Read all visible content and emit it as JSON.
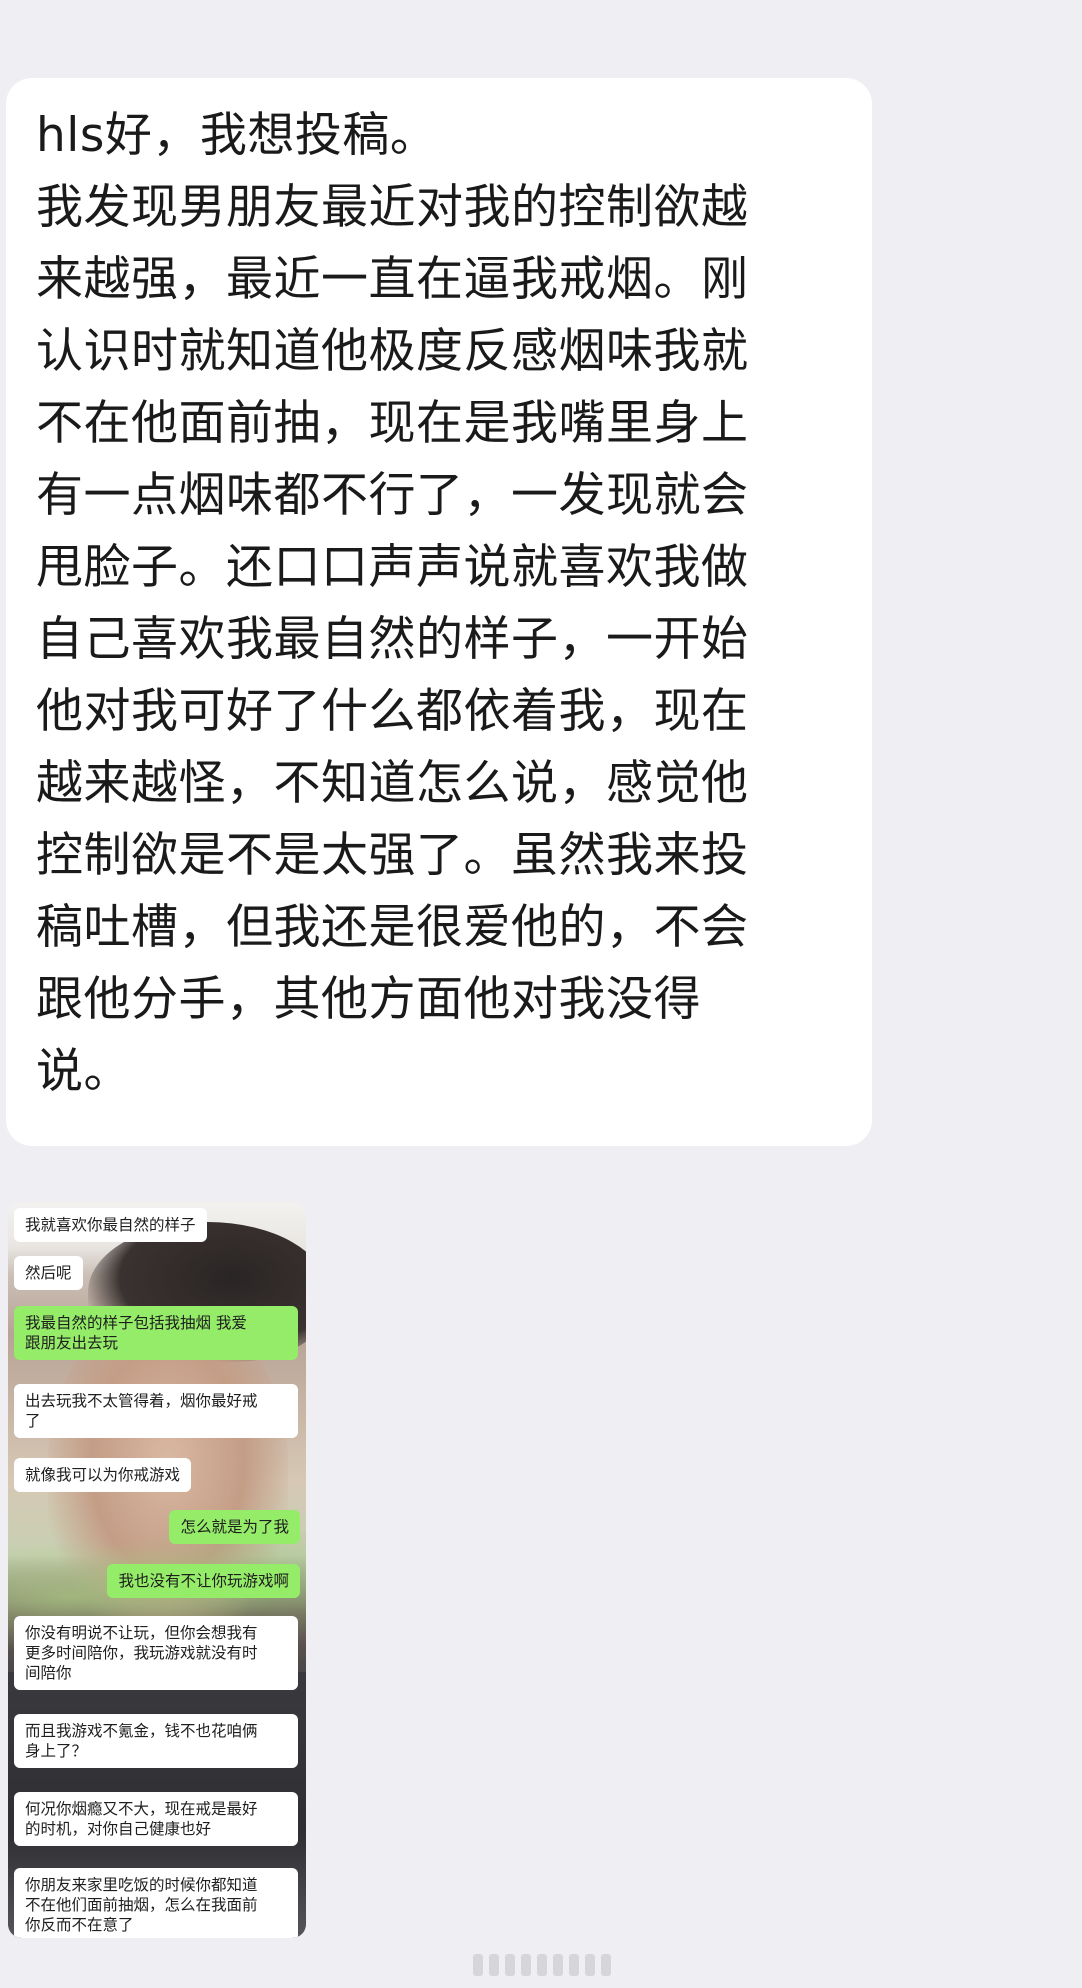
{
  "main_message": {
    "lines": [
      "hls好，我想投稿。",
      "我发现男朋友最近对我的控制欲越",
      "来越强，最近一直在逼我戒烟。刚",
      "认识时就知道他极度反感烟味我就",
      "不在他面前抽，现在是我嘴里身上",
      "有一点烟味都不行了，一发现就会",
      "甩脸子。还口口声声说就喜欢我做",
      "自己喜欢我最自然的样子，一开始",
      "他对我可好了什么都依着我，现在",
      "越来越怪，不知道怎么说，感觉他",
      "控制欲是不是太强了。虽然我来投",
      "稿吐槽，但我还是很爱他的，不会",
      "跟他分手，其他方面他对我没得",
      "说。"
    ]
  },
  "chat_screenshot": {
    "messages": [
      {
        "side": "left",
        "text": "我就喜欢你最自然的样子"
      },
      {
        "side": "left",
        "text": "然后呢"
      },
      {
        "side": "right",
        "text": "我最自然的样子包括我抽烟 我爱\n跟朋友出去玩"
      },
      {
        "side": "left",
        "text": "出去玩我不太管得着，烟你最好戒\n了"
      },
      {
        "side": "left",
        "text": "就像我可以为你戒游戏"
      },
      {
        "side": "right",
        "text": "怎么就是为了我"
      },
      {
        "side": "right",
        "text": "我也没有不让你玩游戏啊"
      },
      {
        "side": "left",
        "text": "你没有明说不让玩，但你会想我有\n更多时间陪你，我玩游戏就没有时\n间陪你"
      },
      {
        "side": "left",
        "text": "而且我游戏不氪金，钱不也花咱俩\n身上了？"
      },
      {
        "side": "left",
        "text": "何况你烟瘾又不大，现在戒是最好\n的时机，对你自己健康也好"
      },
      {
        "side": "left",
        "text": "你朋友来家里吃饭的时候你都知道\n不在他们面前抽烟，怎么在我面前\n你反而不在意了"
      }
    ]
  },
  "colors": {
    "page_bg": "#efeff3",
    "bubble_bg": "#ffffff",
    "sent_bubble": "#95ec69",
    "received_bubble": "#ffffff"
  },
  "page_indicator": {
    "count": 9
  }
}
